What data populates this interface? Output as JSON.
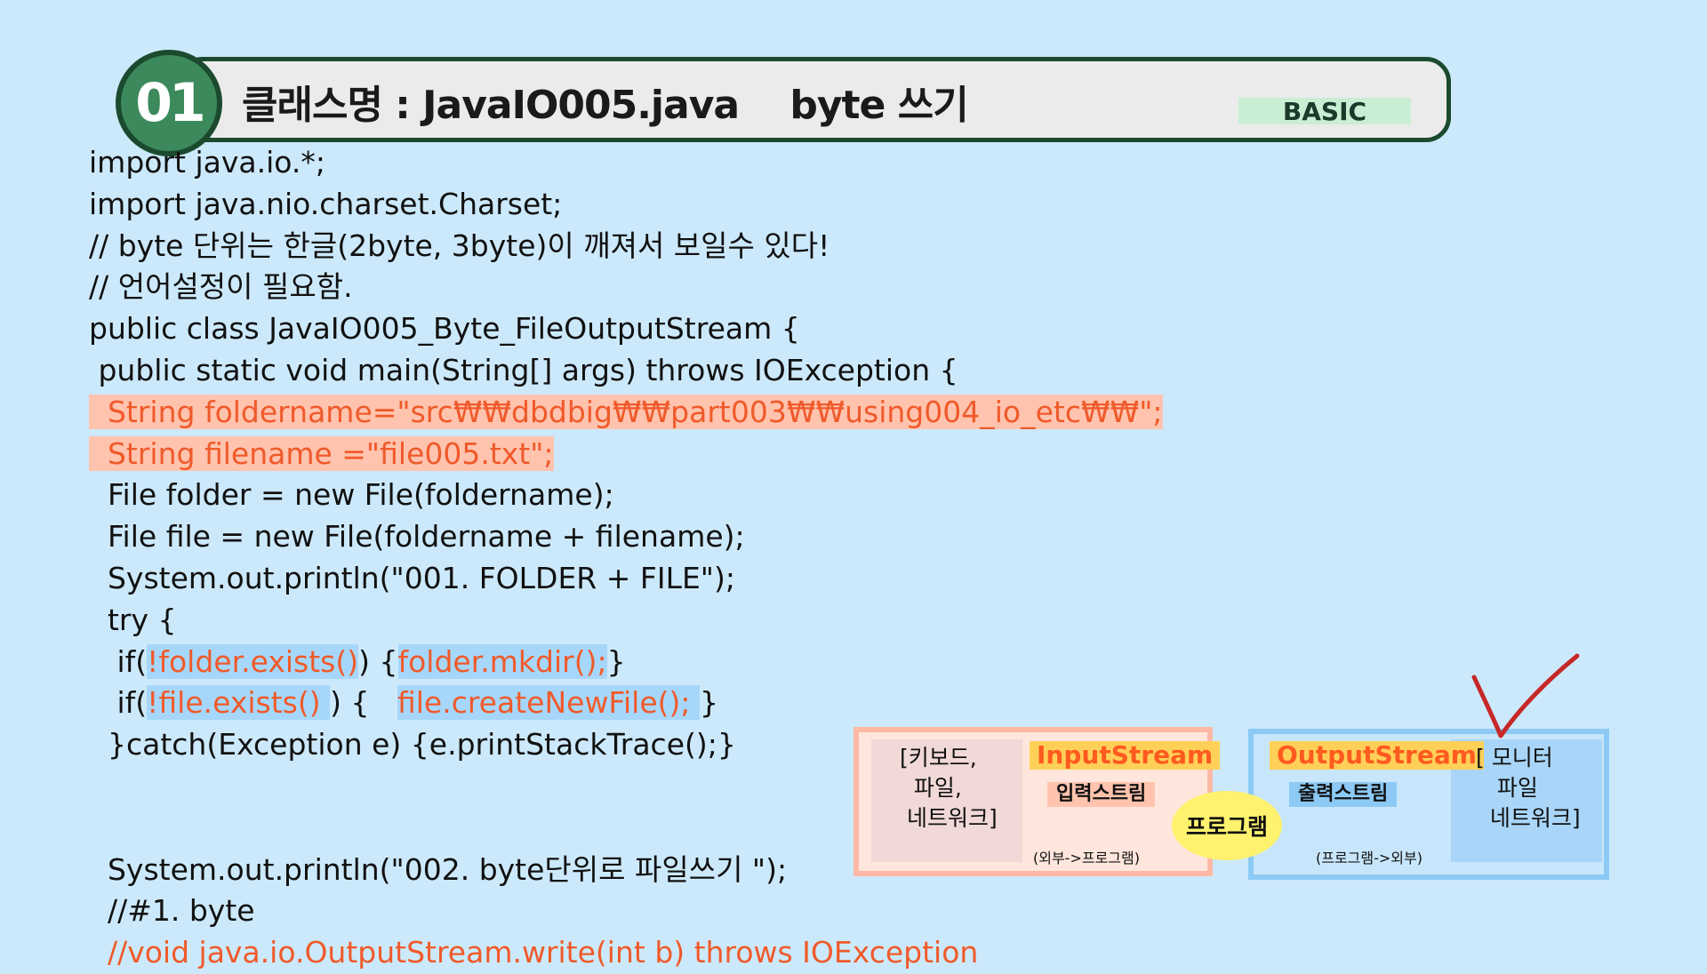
{
  "header": {
    "number": "01",
    "title": "클래스명 : JavaIO005.java    byte 쓰기",
    "level": "BASIC"
  },
  "code_lines": [
    "import java.io.*;",
    "import java.nio.charset.Charset;",
    "// byte 단위는 한글(2byte, 3byte)이 깨져서 보일수 있다!",
    "// 언어설정이 필요함.",
    "public class JavaIO005_Byte_FileOutputStream {",
    " public static void main(String[] args) throws IOException {",
    "  String foldername=\"src₩₩dbdbig₩₩part003₩₩using004_io_etc₩₩\";",
    "  String filename =\"file005.txt\";",
    "  File folder = new File(foldername);",
    "  File file = new File(foldername + filename);",
    "  System.out.println(\"001. FOLDER + FILE\");",
    "  try {",
    "   if(!folder.exists()) {folder.mkdir();}",
    "   if(!file.exists() ) {   file.createNewFile(); }",
    "  }catch(Exception e) {e.printStackTrace();}",
    "",
    "",
    "  System.out.println(\"002. byte단위로 파일쓰기 \");",
    "  //#1. byte",
    "  //void java.io.OutputStream.write(int b) throws IOException"
  ],
  "code_fragments": {
    "if1_prefix": "   if(",
    "if1_cond": "!folder.exists()",
    "if1_mid": ") {",
    "if1_body": "folder.mkdir();",
    "if1_end": "}",
    "if2_prefix": "   if(",
    "if2_cond": "!file.exists() ",
    "if2_mid": ") {   ",
    "if2_body": "file.createNewFile(); ",
    "if2_end": "}"
  },
  "diagram": {
    "input_device": "[키보드,\n  파일,\n 네트워크]",
    "input_stream": "InputStream",
    "input_stream_ko": "입력스트림",
    "input_direction": "(외부->프로그램)",
    "program": "프로그램",
    "output_stream": "OutputStream",
    "output_stream_ko": "출력스트림",
    "output_direction": "(프로그램->외부)",
    "output_device": "[ 모니터\n   파일\n  네트워크]"
  },
  "colors": {
    "background": "#cce9fb",
    "header_border": "#1b4a2e",
    "badge": "#3c8a5c",
    "highlight_salmon": "#ffc3ae",
    "highlight_blue": "#a6d7fb",
    "accent_orange": "#f05a2a",
    "checkmark": "#c62828"
  },
  "icons": [
    "checkmark-icon"
  ]
}
